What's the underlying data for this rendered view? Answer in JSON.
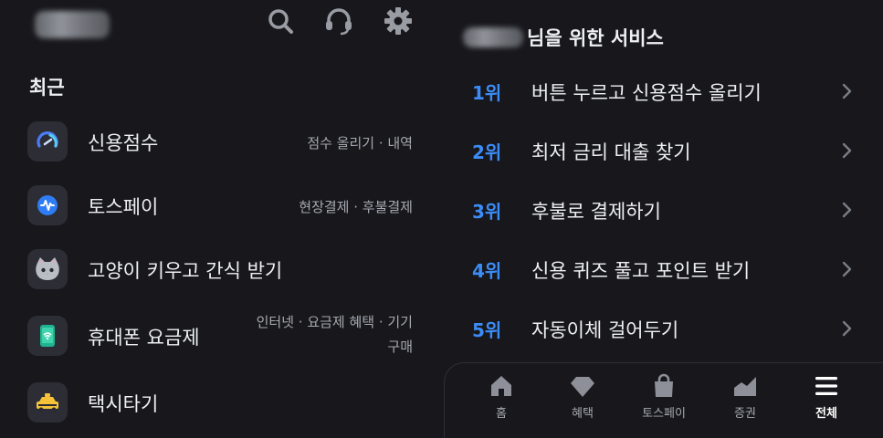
{
  "header": {
    "icons": [
      "search-icon",
      "headset-icon",
      "gear-icon"
    ]
  },
  "recent": {
    "title": "최근",
    "items": [
      {
        "label": "신용점수",
        "sub": "점수 올리기 · 내역",
        "icon": "credit-gauge-icon"
      },
      {
        "label": "토스페이",
        "sub": "현장결제 · 후불결제",
        "icon": "toss-pay-icon"
      },
      {
        "label": "고양이 키우고 간식 받기",
        "sub": "",
        "icon": "cat-icon"
      },
      {
        "label": "휴대폰 요금제",
        "sub_line1": "인터넷 · 요금제 혜택 · 기기",
        "sub_line2": "구매",
        "icon": "phone-plan-icon"
      },
      {
        "label": "택시타기",
        "sub": "",
        "icon": "taxi-icon"
      }
    ]
  },
  "services": {
    "title_suffix": "님을 위한 서비스",
    "ranks": [
      {
        "rank": "1위",
        "text": "버튼 누르고 신용점수 올리기"
      },
      {
        "rank": "2위",
        "text": "최저 금리 대출 찾기"
      },
      {
        "rank": "3위",
        "text": "후불로 결제하기"
      },
      {
        "rank": "4위",
        "text": "신용 퀴즈 풀고 포인트 받기"
      },
      {
        "rank": "5위",
        "text": "자동이체 걸어두기"
      }
    ]
  },
  "tabbar": {
    "tabs": [
      {
        "label": "홈",
        "icon": "home-icon",
        "active": false
      },
      {
        "label": "혜택",
        "icon": "diamond-icon",
        "active": false
      },
      {
        "label": "토스페이",
        "icon": "shopping-bag-icon",
        "active": false
      },
      {
        "label": "증권",
        "icon": "stock-chart-icon",
        "active": false
      },
      {
        "label": "전체",
        "icon": "menu-icon",
        "active": true
      }
    ]
  },
  "colors": {
    "background": "#17171c",
    "rank_accent": "#3c8cf6",
    "icon_tile": "#2c2d35"
  }
}
